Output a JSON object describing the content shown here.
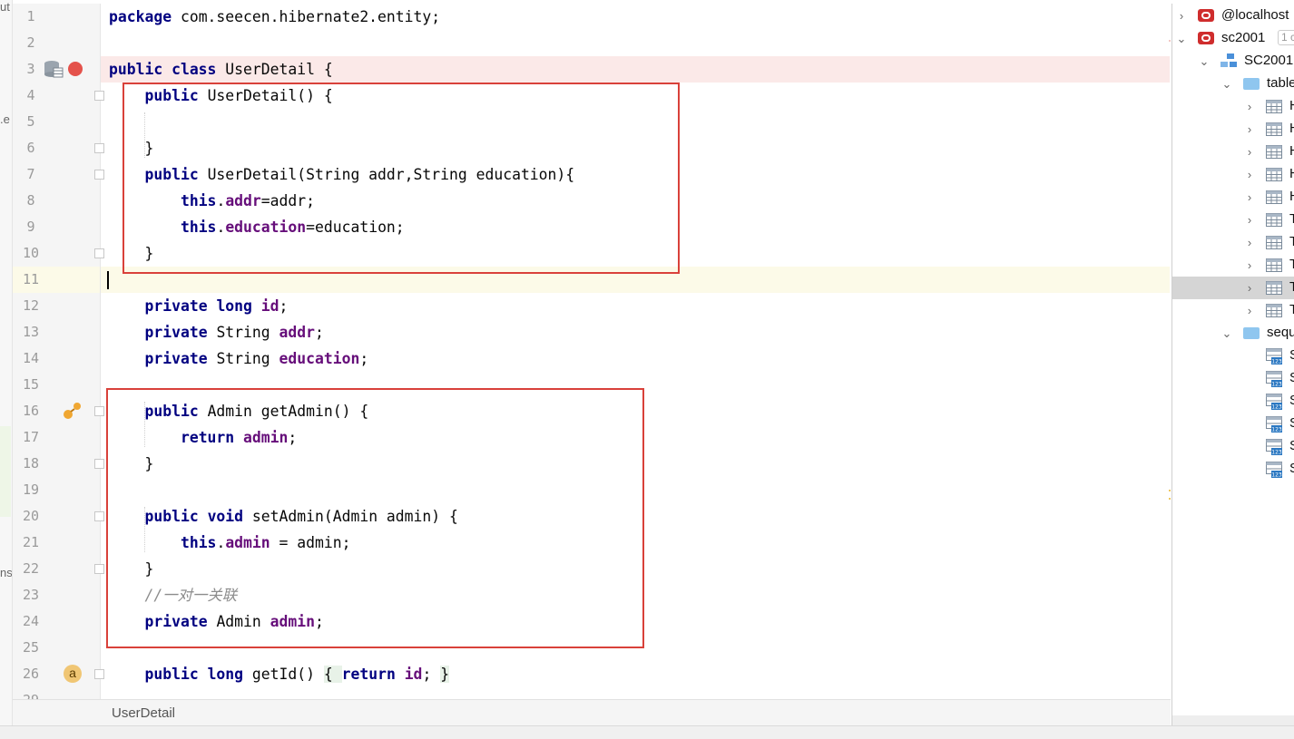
{
  "editor": {
    "lines": [
      {
        "n": "1",
        "tokens": [
          {
            "t": "package ",
            "c": "kw"
          },
          {
            "t": "com.seecen.hibernate2.entity;"
          }
        ]
      },
      {
        "n": "2",
        "tokens": []
      },
      {
        "n": "3",
        "tokens": [
          {
            "t": "public ",
            "c": "kw"
          },
          {
            "t": "class ",
            "c": "kw"
          },
          {
            "t": "UserDetail {"
          }
        ]
      },
      {
        "n": "4",
        "tokens": [
          {
            "t": "    "
          },
          {
            "t": "public ",
            "c": "kw"
          },
          {
            "t": "UserDetail() {"
          }
        ]
      },
      {
        "n": "5",
        "tokens": []
      },
      {
        "n": "6",
        "tokens": [
          {
            "t": "    }"
          }
        ]
      },
      {
        "n": "7",
        "tokens": [
          {
            "t": "    "
          },
          {
            "t": "public ",
            "c": "kw"
          },
          {
            "t": "UserDetail(String addr,String education){"
          }
        ]
      },
      {
        "n": "8",
        "tokens": [
          {
            "t": "        "
          },
          {
            "t": "this",
            "c": "kw"
          },
          {
            "t": "."
          },
          {
            "t": "addr",
            "c": "fld"
          },
          {
            "t": "=addr;"
          }
        ]
      },
      {
        "n": "9",
        "tokens": [
          {
            "t": "        "
          },
          {
            "t": "this",
            "c": "kw"
          },
          {
            "t": "."
          },
          {
            "t": "education",
            "c": "fld"
          },
          {
            "t": "=education;"
          }
        ]
      },
      {
        "n": "10",
        "tokens": [
          {
            "t": "    }"
          }
        ]
      },
      {
        "n": "11",
        "tokens": []
      },
      {
        "n": "12",
        "tokens": [
          {
            "t": "    "
          },
          {
            "t": "private ",
            "c": "kw"
          },
          {
            "t": "long ",
            "c": "kw"
          },
          {
            "t": "id",
            "c": "fld"
          },
          {
            "t": ";"
          }
        ]
      },
      {
        "n": "13",
        "tokens": [
          {
            "t": "    "
          },
          {
            "t": "private ",
            "c": "kw"
          },
          {
            "t": "String "
          },
          {
            "t": "addr",
            "c": "fld"
          },
          {
            "t": ";"
          }
        ]
      },
      {
        "n": "14",
        "tokens": [
          {
            "t": "    "
          },
          {
            "t": "private ",
            "c": "kw"
          },
          {
            "t": "String "
          },
          {
            "t": "education",
            "c": "fld"
          },
          {
            "t": ";"
          }
        ]
      },
      {
        "n": "15",
        "tokens": []
      },
      {
        "n": "16",
        "tokens": [
          {
            "t": "    "
          },
          {
            "t": "public ",
            "c": "kw"
          },
          {
            "t": "Admin getAdmin() {"
          }
        ]
      },
      {
        "n": "17",
        "tokens": [
          {
            "t": "        "
          },
          {
            "t": "return ",
            "c": "kw"
          },
          {
            "t": "admin",
            "c": "fld"
          },
          {
            "t": ";"
          }
        ]
      },
      {
        "n": "18",
        "tokens": [
          {
            "t": "    }"
          }
        ]
      },
      {
        "n": "19",
        "tokens": []
      },
      {
        "n": "20",
        "tokens": [
          {
            "t": "    "
          },
          {
            "t": "public ",
            "c": "kw"
          },
          {
            "t": "void ",
            "c": "kw"
          },
          {
            "t": "setAdmin(Admin admin) {"
          }
        ]
      },
      {
        "n": "21",
        "tokens": [
          {
            "t": "        "
          },
          {
            "t": "this",
            "c": "kw"
          },
          {
            "t": "."
          },
          {
            "t": "admin",
            "c": "fld"
          },
          {
            "t": " = admin;"
          }
        ]
      },
      {
        "n": "22",
        "tokens": [
          {
            "t": "    }"
          }
        ]
      },
      {
        "n": "23",
        "tokens": [
          {
            "t": "    "
          },
          {
            "t": "//一对一关联",
            "c": "cmt"
          }
        ]
      },
      {
        "n": "24",
        "tokens": [
          {
            "t": "    "
          },
          {
            "t": "private ",
            "c": "kw"
          },
          {
            "t": "Admin "
          },
          {
            "t": "admin",
            "c": "fld"
          },
          {
            "t": ";"
          }
        ]
      },
      {
        "n": "25",
        "tokens": []
      },
      {
        "n": "26",
        "tokens": [
          {
            "t": "    "
          },
          {
            "t": "public ",
            "c": "kw"
          },
          {
            "t": "long ",
            "c": "kw"
          },
          {
            "t": "getId() "
          },
          {
            "t": "{ ",
            "c": "hl"
          },
          {
            "t": "return ",
            "c": "kw"
          },
          {
            "t": "id",
            "c": "fld"
          },
          {
            "t": "; "
          },
          {
            "t": "}",
            "c": "hl"
          }
        ]
      },
      {
        "n": "29",
        "tokens": []
      }
    ],
    "breakpoint_line": "3",
    "current_line": "11",
    "gutter_annotation": "a",
    "breadcrumb": "UserDetail"
  },
  "left_sliver": {
    "fragments": [
      "ut",
      ".e",
      "ns"
    ]
  },
  "db_tree": {
    "connection_label": "@localhost",
    "database_label": "sc2001",
    "database_badge": "1 c",
    "schema_label": "SC2001",
    "tables_folder_label": "table",
    "table_items": [
      "H",
      "H",
      "H",
      "H",
      "H",
      "T",
      "T",
      "T",
      "T",
      "T"
    ],
    "selected_table_index": 8,
    "sequences_folder_label": "sequ",
    "sequence_items": [
      "S",
      "S",
      "S",
      "S",
      "S",
      "S"
    ]
  },
  "colors": {
    "keyword": "#000080",
    "field": "#660e7a",
    "comment": "#8c8c8c",
    "breakpoint": "#e4524b",
    "annotation_box": "#d9413a"
  }
}
